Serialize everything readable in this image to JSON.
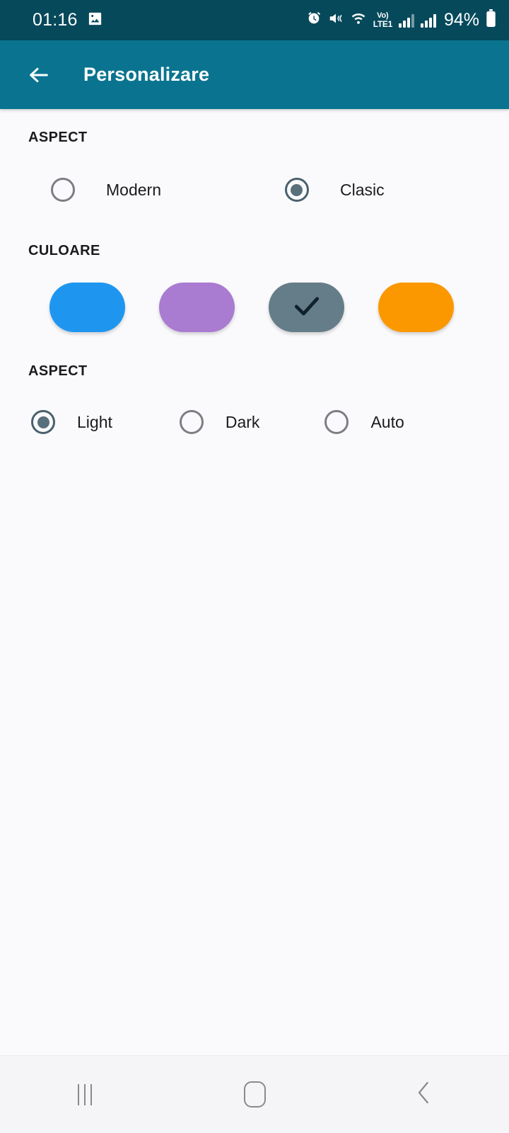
{
  "status_bar": {
    "time": "01:16",
    "battery_percent": "94%",
    "volte_label_top": "Vo)",
    "volte_label_bottom": "LTE1",
    "icons": [
      "gallery-icon",
      "alarm-icon",
      "mute-vibrate-icon",
      "wifi-icon",
      "volte-icon",
      "signal-icon-sim1",
      "signal-icon-sim2",
      "battery-icon"
    ],
    "background_color": "#06495B"
  },
  "app_bar": {
    "title": "Personalizare",
    "back_label": "back-arrow",
    "background_color": "#0A7490"
  },
  "sections": {
    "aspect_style": {
      "header": "ASPECT",
      "options": [
        {
          "label": "Modern",
          "selected": false
        },
        {
          "label": "Clasic",
          "selected": true
        }
      ]
    },
    "culoare": {
      "header": "CULOARE",
      "swatches": [
        {
          "name": "blue",
          "color": "#1E96F0",
          "selected": false
        },
        {
          "name": "purple",
          "color": "#A97BD1",
          "selected": false
        },
        {
          "name": "slate",
          "color": "#657D88",
          "selected": true
        },
        {
          "name": "orange",
          "color": "#FB9800",
          "selected": false
        }
      ]
    },
    "aspect_theme": {
      "header": "ASPECT",
      "options": [
        {
          "label": "Light",
          "selected": true
        },
        {
          "label": "Dark",
          "selected": false
        },
        {
          "label": "Auto",
          "selected": false
        }
      ]
    }
  },
  "nav_bar": {
    "recents_label": "recents-button",
    "home_label": "home-button",
    "back_label": "back-button"
  }
}
